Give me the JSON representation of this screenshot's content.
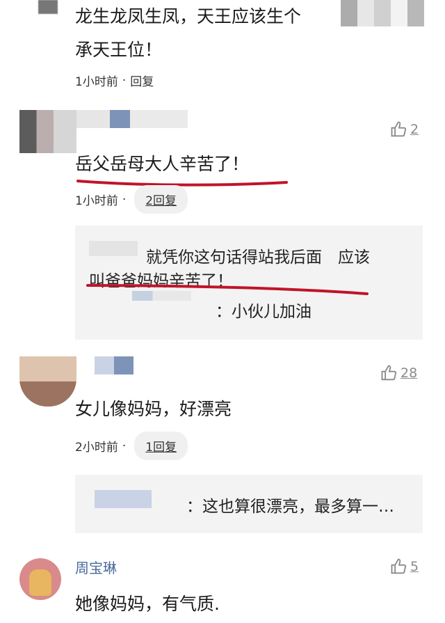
{
  "comments": [
    {
      "text_line1": "龙生龙凤生凤，天王应该生个",
      "text_line2": "承天王位！",
      "time": "1小时前",
      "reply_label": "回复"
    },
    {
      "text": "岳父岳母大人辛苦了！",
      "time": "1小时前",
      "reply_label": "2回复",
      "likes": "2",
      "reply": {
        "line1": "就凭你这句话得站我后面　应该",
        "line2": "叫爸爸妈妈辛苦了！",
        "line3": "：小伙儿加油"
      }
    },
    {
      "text": "女儿像妈妈，好漂亮",
      "time": "2小时前",
      "reply_label": "1回复",
      "likes": "28",
      "reply": {
        "line1": "：这也算很漂亮，最多算一…"
      }
    },
    {
      "username": "周宝琳",
      "text": "她像妈妈，有气质.",
      "likes": "5"
    }
  ],
  "colors": {
    "underline_red": "#c0142a",
    "username_blue": "#4a6a9a",
    "reply_bg": "#f3f3f3"
  },
  "icons": {
    "like": "thumbs-up-icon"
  }
}
